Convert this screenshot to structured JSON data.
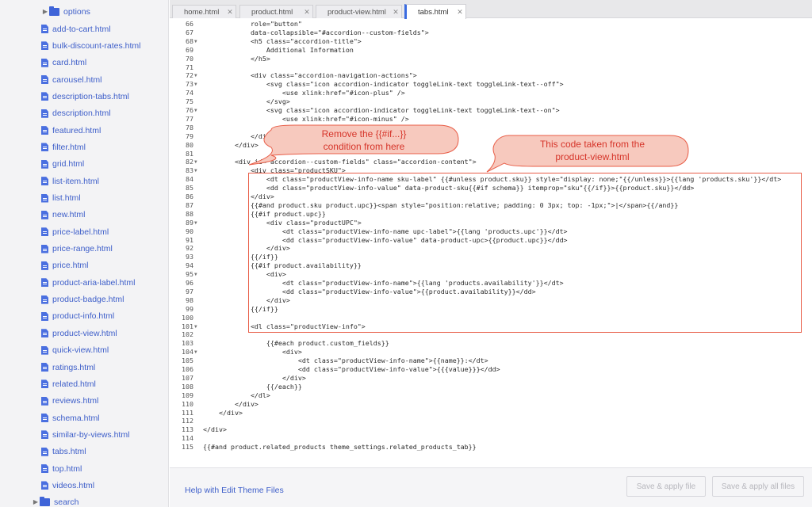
{
  "sidebar": {
    "top_folder": "options",
    "files": [
      "add-to-cart.html",
      "bulk-discount-rates.html",
      "card.html",
      "carousel.html",
      "description-tabs.html",
      "description.html",
      "featured.html",
      "filter.html",
      "grid.html",
      "list-item.html",
      "list.html",
      "new.html",
      "price-label.html",
      "price-range.html",
      "price.html",
      "product-aria-label.html",
      "product-badge.html",
      "product-info.html",
      "product-view.html",
      "quick-view.html",
      "ratings.html",
      "related.html",
      "reviews.html",
      "schema.html",
      "similar-by-views.html",
      "tabs.html",
      "top.html",
      "videos.html"
    ],
    "bottom_folder": "search"
  },
  "tabs": [
    {
      "label": "home.html"
    },
    {
      "label": "product.html"
    },
    {
      "label": "product-view.html"
    },
    {
      "label": "tabs.html",
      "active": true
    }
  ],
  "editor": {
    "lines": [
      {
        "n": "66",
        "fold": false,
        "t": "            role=\"button\""
      },
      {
        "n": "67",
        "fold": false,
        "t": "            data-collapsible=\"#accordion--custom-fields\">"
      },
      {
        "n": "68",
        "fold": true,
        "t": "            <h5 class=\"accordion-title\">"
      },
      {
        "n": "69",
        "fold": false,
        "t": "                Additional Information"
      },
      {
        "n": "70",
        "fold": false,
        "t": "            </h5>"
      },
      {
        "n": "71",
        "fold": false,
        "t": ""
      },
      {
        "n": "72",
        "fold": true,
        "t": "            <div class=\"accordion-navigation-actions\">"
      },
      {
        "n": "73",
        "fold": true,
        "t": "                <svg class=\"icon accordion-indicator toggleLink-text toggleLink-text--off\">"
      },
      {
        "n": "74",
        "fold": false,
        "t": "                    <use xlink:href=\"#icon-plus\" />"
      },
      {
        "n": "75",
        "fold": false,
        "t": "                </svg>"
      },
      {
        "n": "76",
        "fold": true,
        "t": "                <svg class=\"icon accordion-indicator toggleLink-text toggleLink-text--on\">"
      },
      {
        "n": "77",
        "fold": false,
        "t": "                    <use xlink:href=\"#icon-minus\" />"
      },
      {
        "n": "78",
        "fold": false,
        "t": ""
      },
      {
        "n": "79",
        "fold": false,
        "t": "            </div>"
      },
      {
        "n": "80",
        "fold": false,
        "t": "        </div>"
      },
      {
        "n": "81",
        "fold": false,
        "t": ""
      },
      {
        "n": "82",
        "fold": true,
        "t": "        <div id=\"accordion--custom-fields\" class=\"accordion-content\">"
      },
      {
        "n": "83",
        "fold": true,
        "t": "            <div class=\"productSKU\">"
      },
      {
        "n": "84",
        "fold": false,
        "t": "                <dt class=\"productView-info-name sku-label\" {{#unless product.sku}} style=\"display: none;\"{{/unless}}>{{lang 'products.sku'}}</dt>"
      },
      {
        "n": "85",
        "fold": false,
        "t": "                <dd class=\"productView-info-value\" data-product-sku{{#if schema}} itemprop=\"sku\"{{/if}}>{{product.sku}}</dd>"
      },
      {
        "n": "86",
        "fold": false,
        "t": "            </div>"
      },
      {
        "n": "87",
        "fold": false,
        "t": "            {{#and product.sku product.upc}}<span style=\"position:relative; padding: 0 3px; top: -1px;\">|</span>{{/and}}"
      },
      {
        "n": "88",
        "fold": false,
        "t": "            {{#if product.upc}}"
      },
      {
        "n": "89",
        "fold": true,
        "t": "                <div class=\"productUPC\">"
      },
      {
        "n": "90",
        "fold": false,
        "t": "                    <dt class=\"productView-info-name upc-label\">{{lang 'products.upc'}}</dt>"
      },
      {
        "n": "91",
        "fold": false,
        "t": "                    <dd class=\"productView-info-value\" data-product-upc>{{product.upc}}</dd>"
      },
      {
        "n": "92",
        "fold": false,
        "t": "                </div>"
      },
      {
        "n": "93",
        "fold": false,
        "t": "            {{/if}}"
      },
      {
        "n": "94",
        "fold": false,
        "t": "            {{#if product.availability}}"
      },
      {
        "n": "95",
        "fold": true,
        "t": "                <div>"
      },
      {
        "n": "96",
        "fold": false,
        "t": "                    <dt class=\"productView-info-name\">{{lang 'products.availability'}}</dt>"
      },
      {
        "n": "97",
        "fold": false,
        "t": "                    <dd class=\"productView-info-value\">{{product.availability}}</dd>"
      },
      {
        "n": "98",
        "fold": false,
        "t": "                </div>"
      },
      {
        "n": "99",
        "fold": false,
        "t": "            {{/if}}"
      },
      {
        "n": "100",
        "fold": false,
        "t": ""
      },
      {
        "n": "101",
        "fold": true,
        "t": "            <dl class=\"productView-info\">"
      },
      {
        "n": "102",
        "fold": false,
        "t": ""
      },
      {
        "n": "103",
        "fold": false,
        "t": "                {{#each product.custom_fields}}"
      },
      {
        "n": "104",
        "fold": true,
        "t": "                    <div>"
      },
      {
        "n": "105",
        "fold": false,
        "t": "                        <dt class=\"productView-info-name\">{{name}}:</dt>"
      },
      {
        "n": "106",
        "fold": false,
        "t": "                        <dd class=\"productView-info-value\">{{{value}}}</dd>"
      },
      {
        "n": "107",
        "fold": false,
        "t": "                    </div>"
      },
      {
        "n": "108",
        "fold": false,
        "t": "                {{/each}}"
      },
      {
        "n": "109",
        "fold": false,
        "t": "            </dl>"
      },
      {
        "n": "110",
        "fold": false,
        "t": "        </div>"
      },
      {
        "n": "111",
        "fold": false,
        "t": "    </div>"
      },
      {
        "n": "112",
        "fold": false,
        "t": ""
      },
      {
        "n": "113",
        "fold": false,
        "t": "</div>"
      },
      {
        "n": "114",
        "fold": false,
        "t": ""
      },
      {
        "n": "115",
        "fold": false,
        "t": "{{#and product.related_products theme_settings.related_products_tab}}"
      }
    ]
  },
  "annotations": {
    "remove_line1": "Remove the {{#if...}}",
    "remove_line2": "condition from here",
    "taken_line1": "This code taken from the",
    "taken_line2": "product-view.html",
    "accent": "#e85d47"
  },
  "footer": {
    "help": "Help with Edit Theme Files",
    "save_file": "Save & apply file",
    "save_all": "Save & apply all files"
  }
}
